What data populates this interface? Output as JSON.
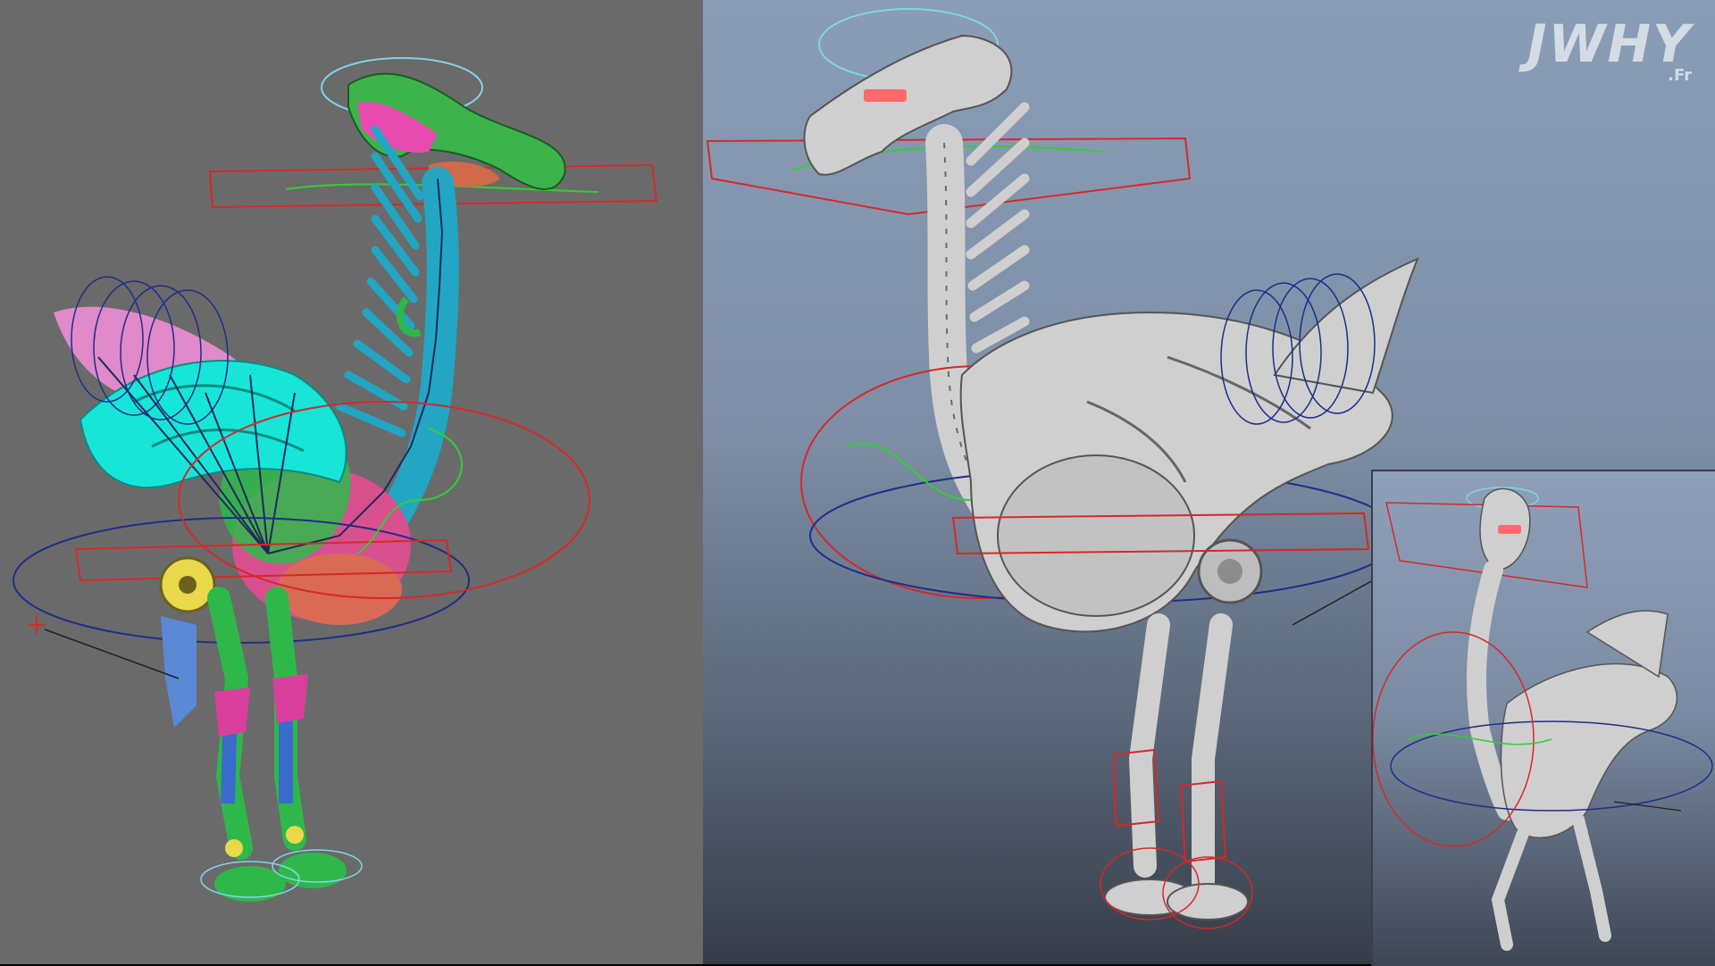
{
  "logo": {
    "main": "JWHY",
    "sub": ".Fr"
  },
  "panels": [
    {
      "name": "color-coded-rig-view"
    },
    {
      "name": "gray-shaded-rig-view"
    },
    {
      "name": "inset-perspective-view"
    }
  ],
  "colors": {
    "viewport_gray": "#6a6a6a",
    "viewport_blue_top": "#8a9db6",
    "viewport_blue_bottom": "#363d48",
    "controller_red": "#d62828",
    "controller_blue": "#1f2d8a",
    "controller_green": "#2fd12f",
    "controller_cyan": "#7fd6e6",
    "mesh_cyan": "#17e5d8",
    "mesh_pink": "#e84bb0",
    "mesh_green": "#2fb84a",
    "mesh_teal": "#22a6c4",
    "mesh_yellow": "#e9d84a",
    "mesh_gray": "#cfcfcf"
  },
  "icons": [
    "bird-robot-colored-model",
    "bird-robot-gray-model",
    "rig-controller-curves",
    "joint-chain",
    "watermark-logo"
  ]
}
